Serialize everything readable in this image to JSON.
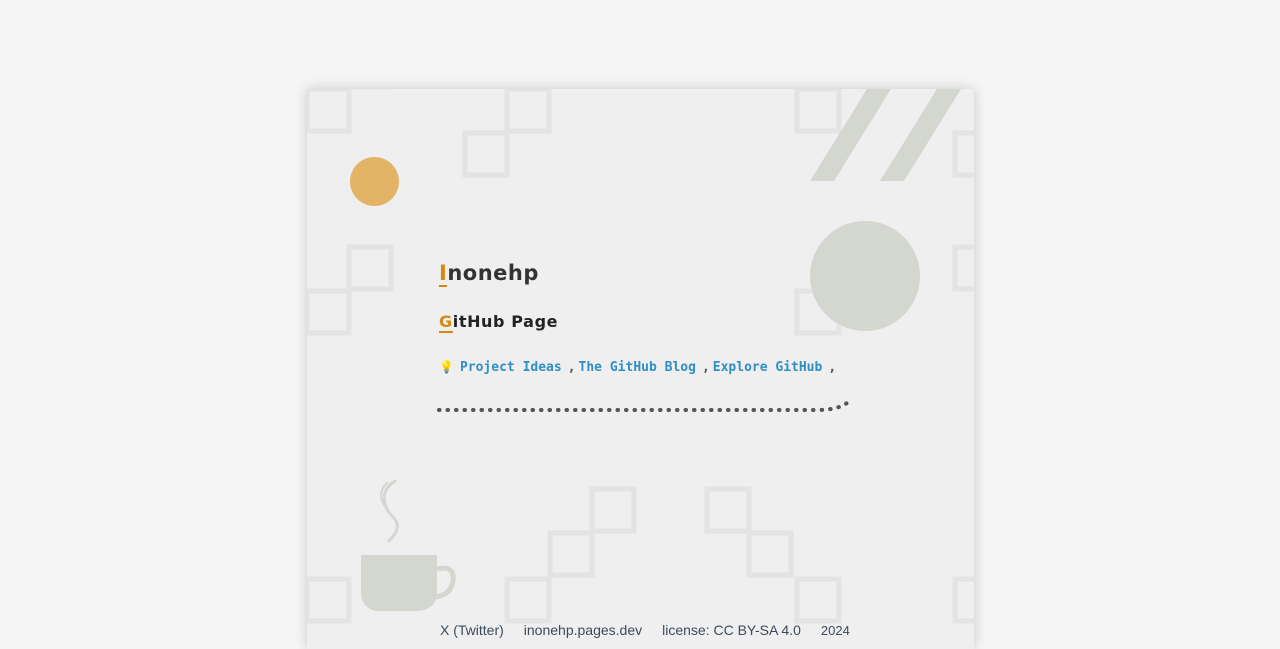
{
  "header": {
    "title": "Inonehp",
    "title_first": "I",
    "title_rest": "nonehp",
    "subtitle_first": "G",
    "subtitle_rest": "itHub Page"
  },
  "links": {
    "icon": "lightbulb-icon",
    "items": [
      {
        "label": "Project Ideas"
      },
      {
        "label": "The GitHub Blog"
      },
      {
        "label": "Explore GitHub"
      }
    ],
    "separator": ","
  },
  "footer": {
    "twitter": "X (Twitter)",
    "site": "inonehp.pages.dev",
    "license": "license: CC BY-SA 4.0",
    "year": "2024"
  },
  "colors": {
    "accent": "#d38a12",
    "link": "#2f8fc4",
    "sun": "#e3b466",
    "shape_gray": "#d4d6d0",
    "background": "#f5f5f5",
    "card": "#efefef"
  }
}
